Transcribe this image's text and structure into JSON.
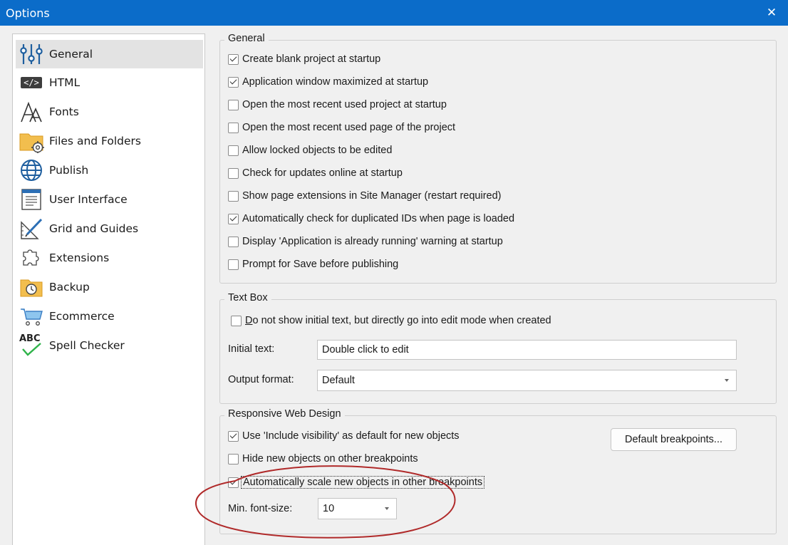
{
  "window": {
    "title": "Options",
    "close_glyph": "✕"
  },
  "sidebar": {
    "items": [
      {
        "label": "General",
        "icon": "sliders-icon",
        "selected": true
      },
      {
        "label": "HTML",
        "icon": "html-tag-icon",
        "icon_text": "</>"
      },
      {
        "label": "Fonts",
        "icon": "fonts-icon"
      },
      {
        "label": "Files and Folders",
        "icon": "folder-gear-icon"
      },
      {
        "label": "Publish",
        "icon": "globe-icon"
      },
      {
        "label": "User Interface",
        "icon": "window-icon"
      },
      {
        "label": "Grid and Guides",
        "icon": "ruler-pencil-icon"
      },
      {
        "label": "Extensions",
        "icon": "puzzle-icon"
      },
      {
        "label": "Backup",
        "icon": "folder-clock-icon"
      },
      {
        "label": "Ecommerce",
        "icon": "cart-icon"
      },
      {
        "label": "Spell Checker",
        "icon": "spell-check-icon",
        "icon_text": "ABC"
      }
    ]
  },
  "general": {
    "legend": "General",
    "options": [
      {
        "label": "Create blank project at startup",
        "checked": true
      },
      {
        "label": "Application window maximized at startup",
        "checked": true
      },
      {
        "label": "Open the most recent used project at startup",
        "checked": false
      },
      {
        "label": "Open the most recent used page of the project",
        "checked": false
      },
      {
        "label": "Allow locked objects to be edited",
        "checked": false
      },
      {
        "label": "Check for updates online at startup",
        "checked": false
      },
      {
        "label": "Show page extensions in Site Manager (restart required)",
        "checked": false
      },
      {
        "label": "Automatically check for duplicated IDs when page is loaded",
        "checked": true
      },
      {
        "label": "Display 'Application is already running' warning at startup",
        "checked": false
      },
      {
        "label": "Prompt for Save before publishing",
        "checked": false
      }
    ]
  },
  "text_box": {
    "legend": "Text Box",
    "direct_edit": {
      "label_first": "D",
      "label_rest": "o not show initial text, but directly go into edit mode when created",
      "checked": false
    },
    "initial_text": {
      "label": "Initial text:",
      "value": "Double click to edit"
    },
    "output_format": {
      "label": "Output format:",
      "value": "Default"
    }
  },
  "responsive": {
    "legend": "Responsive Web Design",
    "include_visibility": {
      "label": "Use 'Include visibility' as default for new objects",
      "checked": true
    },
    "hide_new": {
      "label": "Hide new objects on other breakpoints",
      "checked": false
    },
    "auto_scale": {
      "label": "Automatically scale new objects in other breakpoints",
      "checked": true
    },
    "min_font": {
      "label": "Min. font-size:",
      "value": "10"
    },
    "default_breakpoints_button": "Default breakpoints..."
  },
  "annotation_color": "#b02a2a"
}
